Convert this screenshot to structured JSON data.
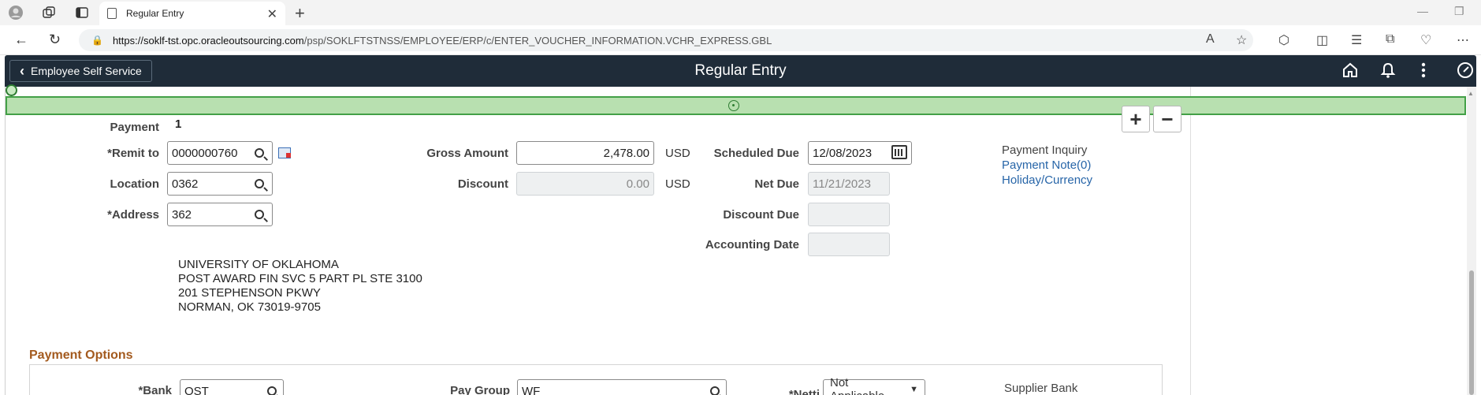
{
  "browser": {
    "tab_title": "Regular Entry",
    "url_host": "https://soklf-tst.opc.oracleoutsourcing.com",
    "url_path": "/psp/SOKLFTSTNSS/EMPLOYEE/ERP/c/ENTER_VOUCHER_INFORMATION.VCHR_EXPRESS.GBL"
  },
  "header": {
    "back_label": "Employee Self Service",
    "title": "Regular Entry"
  },
  "payment": {
    "label": "Payment",
    "number": "1",
    "remit_to_label": "*Remit to",
    "remit_to_value": "0000000760",
    "location_label": "Location",
    "location_value": "0362",
    "address_label": "*Address",
    "address_value": "362",
    "gross_amount_label": "Gross Amount",
    "gross_amount_value": "2,478.00",
    "gross_currency": "USD",
    "discount_label": "Discount",
    "discount_value": "0.00",
    "discount_currency": "USD",
    "scheduled_due_label": "Scheduled Due",
    "scheduled_due_value": "12/08/2023",
    "net_due_label": "Net Due",
    "net_due_value": "11/21/2023",
    "discount_due_label": "Discount Due",
    "discount_due_value": "",
    "accounting_date_label": "Accounting Date",
    "accounting_date_value": "",
    "payment_inquiry": "Payment Inquiry",
    "payment_note": "Payment Note(0)",
    "holiday_currency": "Holiday/Currency",
    "address_lines": [
      "UNIVERSITY OF OKLAHOMA",
      "POST AWARD FIN SVC 5 PART PL STE 3100",
      "201 STEPHENSON PKWY",
      "NORMAN, OK  73019-9705"
    ],
    "add_row": "+",
    "delete_row": "−"
  },
  "payment_options": {
    "heading": "Payment Options",
    "bank_label": "*Bank",
    "bank_value": "OST",
    "pay_group_label": "Pay Group",
    "pay_group_value": "WF",
    "netting_label": "*Netti",
    "netting_value": "Not Applicable",
    "supplier_bank": "Supplier Bank"
  }
}
